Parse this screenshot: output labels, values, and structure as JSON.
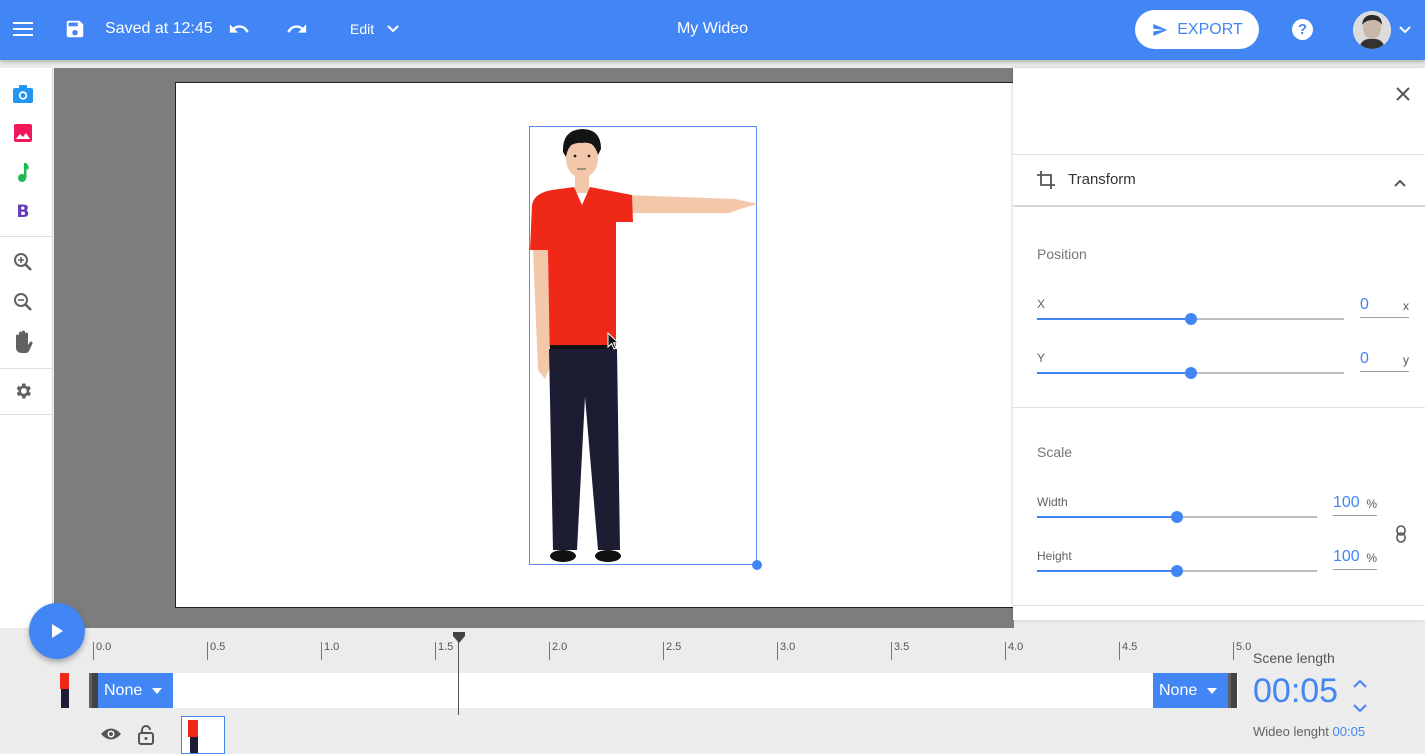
{
  "header": {
    "saved_text": "Saved at 12:45",
    "edit_label": "Edit",
    "title": "My Wideo",
    "export_label": "EXPORT",
    "help_label": "?"
  },
  "left_toolbar": {
    "tools": [
      "camera-icon",
      "image-icon",
      "music-note-icon",
      "text-bold-icon",
      "zoom-in-icon",
      "zoom-out-icon",
      "hand-pan-icon",
      "gear-icon"
    ],
    "text_tool_label": "B"
  },
  "canvas": {
    "character": "standing man pointing right, red t-shirt, navy trousers"
  },
  "panel": {
    "section_title": "Transform",
    "position": {
      "label": "Position",
      "x_label": "X",
      "x_value": "0",
      "x_unit": "x",
      "x_slider": 0.5,
      "y_label": "Y",
      "y_value": "0",
      "y_unit": "y",
      "y_slider": 0.5
    },
    "scale": {
      "label": "Scale",
      "width_label": "Width",
      "width_value": "100",
      "width_unit": "%",
      "width_slider": 0.5,
      "height_label": "Height",
      "height_value": "100",
      "height_unit": "%",
      "height_slider": 0.5
    }
  },
  "timeline": {
    "ticks": [
      "0.0",
      "0.5",
      "1.0",
      "1.5",
      "2.0",
      "2.5",
      "3.0",
      "3.5",
      "4.0",
      "4.5",
      "5.0"
    ],
    "playhead_time": 1.6,
    "enter_animation": "None",
    "exit_animation": "None",
    "scene_length_label": "Scene length",
    "scene_length_value": "00:05",
    "wideo_length_label": "Wideo lenght",
    "wideo_length_value": "00:05"
  },
  "colors": {
    "accent": "#4285f4",
    "shirt": "#f02818",
    "trousers": "#1c1d33"
  }
}
